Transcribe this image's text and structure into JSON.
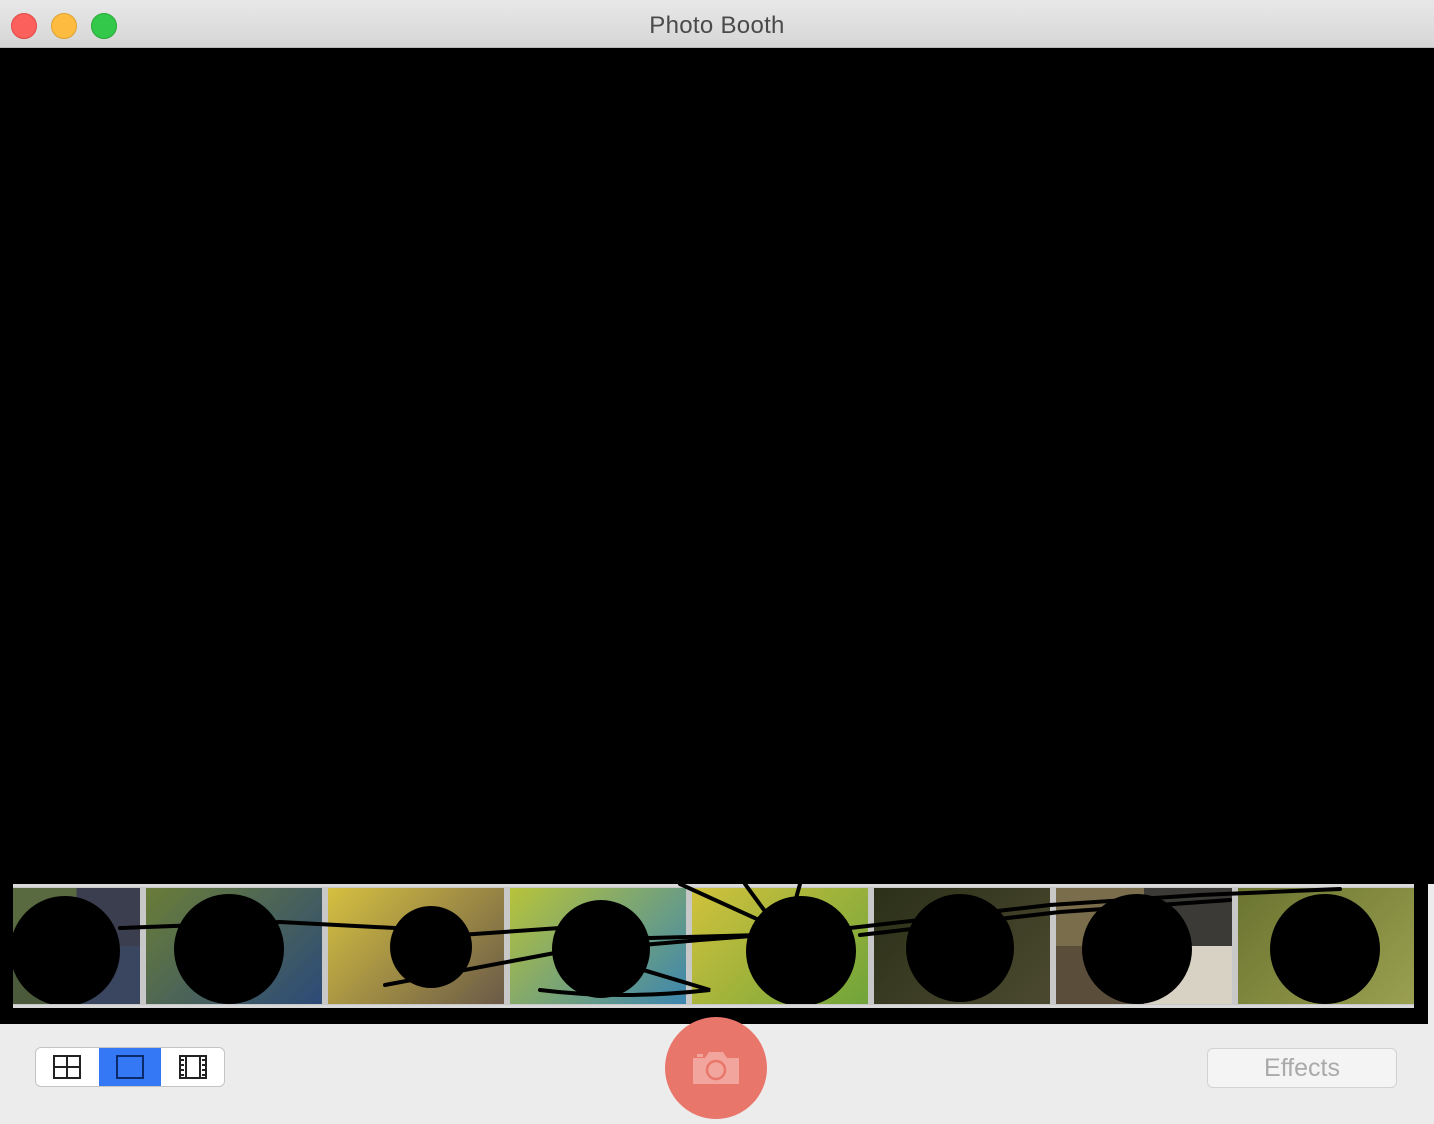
{
  "window": {
    "title": "Photo Booth"
  },
  "toolbar": {
    "view_modes": [
      {
        "name": "four-up",
        "icon": "grid-four-icon",
        "active": false
      },
      {
        "name": "single",
        "icon": "single-frame-icon",
        "active": true
      },
      {
        "name": "strip",
        "icon": "filmstrip-icon",
        "active": false
      }
    ],
    "shutter_icon": "camera-icon",
    "effects_label": "Effects"
  },
  "thumbnails": [
    {
      "kind": "four-up",
      "colors": [
        "#5a6a40",
        "#3b3e4f",
        "#4b5a3a",
        "#3a4660"
      ]
    },
    {
      "kind": "single",
      "colors": [
        "#6a7d38",
        "#2c4a78"
      ]
    },
    {
      "kind": "single",
      "colors": [
        "#d6c040",
        "#6a5a48"
      ]
    },
    {
      "kind": "single",
      "colors": [
        "#b7c33a",
        "#3c86b0"
      ]
    },
    {
      "kind": "single",
      "colors": [
        "#d1c23c",
        "#70a43a"
      ]
    },
    {
      "kind": "single",
      "colors": [
        "#2c3018",
        "#4b4a30"
      ]
    },
    {
      "kind": "four-up",
      "colors": [
        "#7a6d4c",
        "#3c3a36",
        "#5a4e3a",
        "#d8d2c4"
      ]
    },
    {
      "kind": "single",
      "colors": [
        "#6b7430",
        "#9aa050"
      ]
    }
  ],
  "colors": {
    "shutter": "#e9766a",
    "accent": "#3478f6"
  }
}
